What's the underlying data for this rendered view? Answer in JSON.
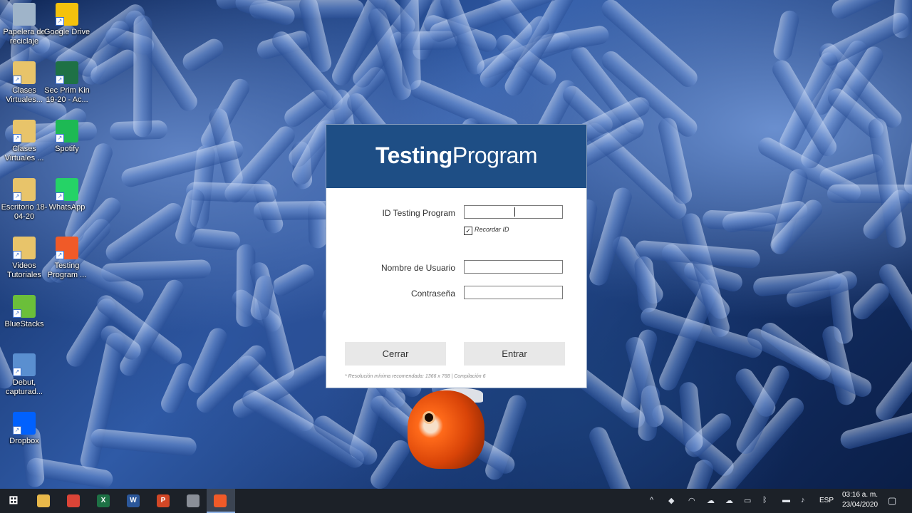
{
  "desktop": {
    "icons": [
      {
        "label": "Papelera de reciclaje",
        "icon": "recycle-bin-icon",
        "color": "#9fb4c9"
      },
      {
        "label": "Google Drive",
        "icon": "google-drive-icon",
        "color": "#f4c20d"
      },
      {
        "label": "Clases Virtuales...",
        "icon": "folder-icon",
        "color": "#e8c46a"
      },
      {
        "label": "Sec Prim Kin 19-20 - Ac...",
        "icon": "excel-file-icon",
        "color": "#1e7145"
      },
      {
        "label": "Clases Virtuales ...",
        "icon": "folder-icon",
        "color": "#e8c46a"
      },
      {
        "label": "Spotify",
        "icon": "spotify-icon",
        "color": "#1db954"
      },
      {
        "label": "Escritorio 18-04-20",
        "icon": "folder-icon",
        "color": "#e8c46a"
      },
      {
        "label": "WhatsApp",
        "icon": "whatsapp-icon",
        "color": "#25d366"
      },
      {
        "label": "Videos Tutoriales",
        "icon": "folder-icon",
        "color": "#e8c46a"
      },
      {
        "label": "Testing Program ...",
        "icon": "testing-program-icon",
        "color": "#f05a28"
      },
      {
        "label": "BlueStacks",
        "icon": "bluestacks-icon",
        "color": "#6bbf3a"
      },
      {
        "label": "Debut, capturad...",
        "icon": "video-file-icon",
        "color": "#5a8fd0"
      },
      {
        "label": "Dropbox",
        "icon": "dropbox-icon",
        "color": "#0061fe"
      }
    ]
  },
  "dialog": {
    "title_bold": "Testing",
    "title_rest": "Program",
    "header_color": "#1e4e85",
    "id_label": "ID Testing Program",
    "id_value": "",
    "remember_label": "Recordar ID",
    "remember_checked": true,
    "username_label": "Nombre de Usuario",
    "username_value": "",
    "password_label": "Contraseña",
    "password_value": "",
    "close_label": "Cerrar",
    "enter_label": "Entrar",
    "footnote": "* Resolución mínima recomendada: 1366 x 768  |  Compilación 6"
  },
  "taskbar": {
    "apps": [
      {
        "name": "windows-start-icon",
        "glyph": "⊞",
        "color": "#1c2128"
      },
      {
        "name": "file-explorer-icon",
        "glyph": "",
        "color": "#e8b84a"
      },
      {
        "name": "chrome-icon",
        "glyph": "",
        "color": "#db4437"
      },
      {
        "name": "excel-icon",
        "glyph": "X",
        "color": "#1e7145"
      },
      {
        "name": "word-icon",
        "glyph": "W",
        "color": "#2b579a"
      },
      {
        "name": "powerpoint-icon",
        "glyph": "P",
        "color": "#d24726"
      },
      {
        "name": "recording-app-icon",
        "glyph": "",
        "color": "#8a8f98"
      },
      {
        "name": "testing-program-icon",
        "glyph": "",
        "color": "#f05a28"
      }
    ],
    "language": "ESP",
    "time": "03:16 a. m.",
    "date": "23/04/2020"
  }
}
